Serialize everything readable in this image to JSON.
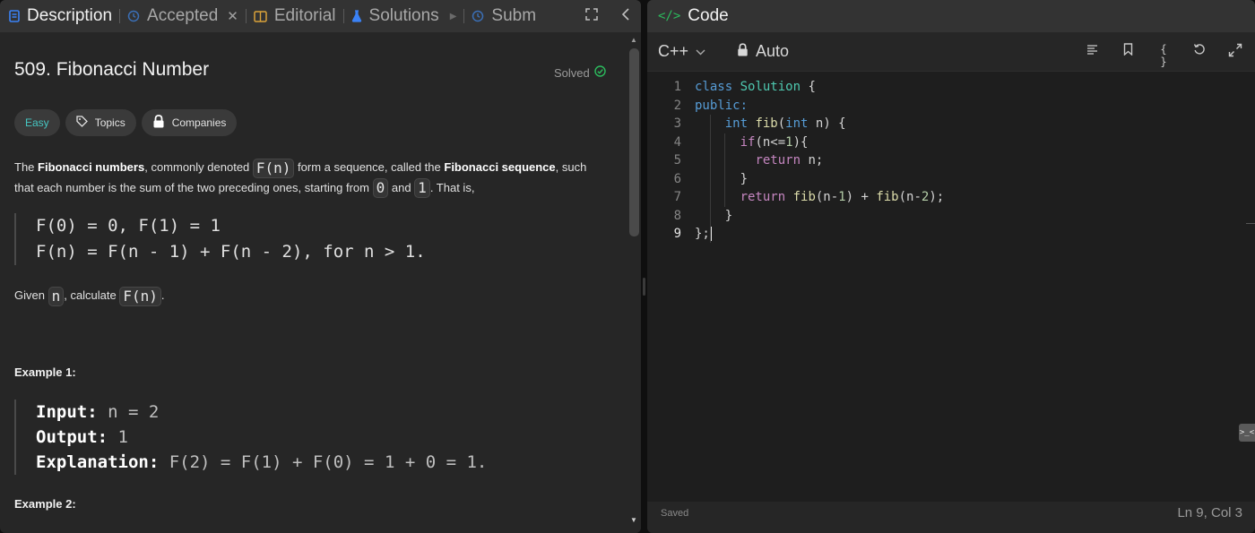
{
  "left_tabs": {
    "description": "Description",
    "accepted": "Accepted",
    "editorial": "Editorial",
    "solutions": "Solutions",
    "submissions": "Subm"
  },
  "problem": {
    "title": "509. Fibonacci Number",
    "status": "Solved",
    "difficulty": "Easy",
    "topics_label": "Topics",
    "companies_label": "Companies"
  },
  "description": {
    "p1_a": "The ",
    "p1_bold1": "Fibonacci numbers",
    "p1_b": ", commonly denoted ",
    "p1_code1": "F(n)",
    "p1_c": " form a sequence, called the ",
    "p1_bold2": "Fibonacci sequence",
    "p1_d": ", such",
    "p2_a": "that each number is the sum of the two preceding ones, starting from ",
    "p2_code1": "0",
    "p2_b": " and ",
    "p2_code2": "1",
    "p2_c": ". That is,",
    "formula_1": "F(0) = 0, F(1) = 1",
    "formula_2": "F(n) = F(n - 1) + F(n - 2), for n > 1.",
    "given_a": "Given ",
    "given_code1": "n",
    "given_b": ", calculate ",
    "given_code2": "F(n)",
    "given_c": "."
  },
  "examples": [
    {
      "title": "Example 1:",
      "input_label": "Input:",
      "input_value": " n = 2",
      "output_label": "Output:",
      "output_value": " 1",
      "explanation_label": "Explanation:",
      "explanation_value": " F(2) = F(1) + F(0) = 1 + 0 = 1."
    },
    {
      "title": "Example 2:"
    }
  ],
  "code_panel": {
    "title": "Code",
    "language": "C++",
    "mode": "Auto",
    "status": "Saved",
    "cursor_position": "Ln 9, Col 3"
  },
  "code": {
    "line_numbers": [
      "1",
      "2",
      "3",
      "4",
      "5",
      "6",
      "7",
      "8",
      "9"
    ],
    "l1_kw": "class",
    "l1_type": " Solution",
    "l1_rest": " {",
    "l2_kw": "public:",
    "l3_indent": "    ",
    "l3_kw": "int",
    "l3_fn": " fib",
    "l3_p1": "(",
    "l3_kw2": "int",
    "l3_rest": " n) {",
    "l4_indent": "      ",
    "l4_kw": "if",
    "l4_p1": "(n<=",
    "l4_num": "1",
    "l4_rest": "){",
    "l5_indent": "        ",
    "l5_kw": "return",
    "l5_rest": " n;",
    "l6": "      }",
    "l7_indent": "      ",
    "l7_kw": "return",
    "l7_fn1": " fib",
    "l7_p1": "(n-",
    "l7_num1": "1",
    "l7_p2": ") + ",
    "l7_fn2": "fib",
    "l7_p3": "(n-",
    "l7_num2": "2",
    "l7_p4": ");",
    "l8": "    }",
    "l9": "};"
  },
  "icons": {
    "description": "document-icon",
    "accepted": "history-icon",
    "editorial": "book-icon",
    "solutions": "flask-icon",
    "code": "code-icon"
  }
}
